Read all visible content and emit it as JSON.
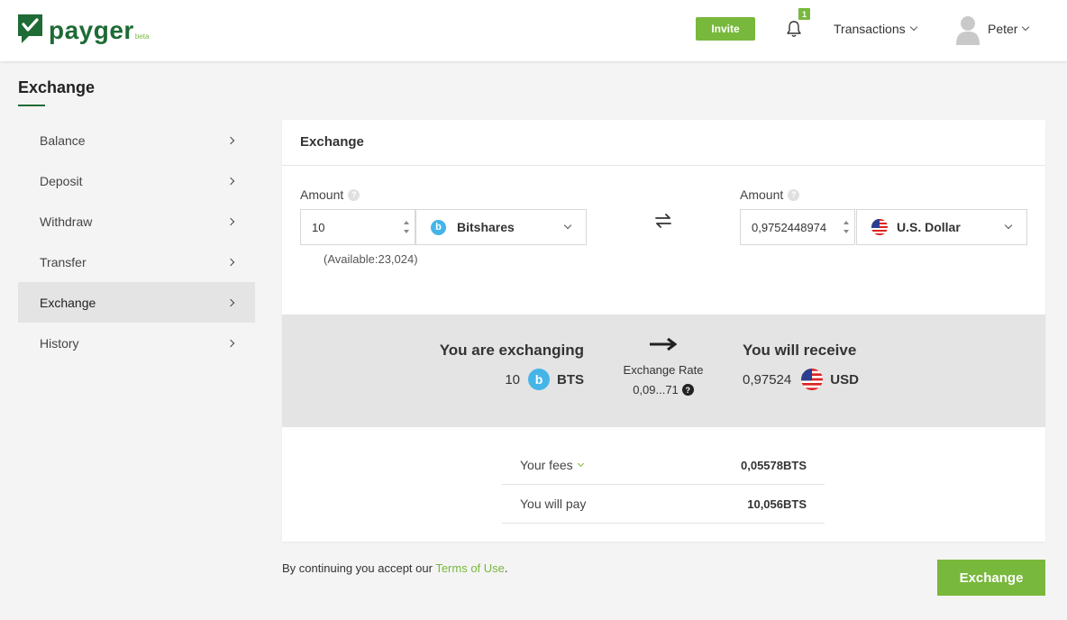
{
  "brand": {
    "name": "payger",
    "tag": "beta",
    "color": "#1e6b35",
    "accent": "#78b83c"
  },
  "header": {
    "invite_label": "Invite",
    "notifications_count": "1",
    "transactions_label": "Transactions",
    "user_name": "Peter"
  },
  "sidebar": {
    "title": "Exchange",
    "items": [
      {
        "label": "Balance"
      },
      {
        "label": "Deposit"
      },
      {
        "label": "Withdraw"
      },
      {
        "label": "Transfer"
      },
      {
        "label": "Exchange",
        "active": true
      },
      {
        "label": "History"
      }
    ]
  },
  "card": {
    "title": "Exchange",
    "from": {
      "amount_label": "Amount",
      "amount_value": "10",
      "currency": "Bitshares",
      "currency_icon": "bitshares-icon",
      "available": "(Available:23,024)"
    },
    "to": {
      "amount_label": "Amount",
      "amount_value": "0,9752448974",
      "currency": "U.S. Dollar",
      "currency_icon": "us-flag-icon"
    },
    "summary": {
      "exchanging_title": "You are exchanging",
      "exchanging_amount": "10",
      "exchanging_currency": "BTS",
      "rate_label": "Exchange Rate",
      "rate_value": "0,09...71",
      "receive_title": "You will receive",
      "receive_amount": "0,97524",
      "receive_currency": "USD"
    },
    "fees": {
      "fees_label": "Your fees",
      "fees_value": "0,05578BTS",
      "pay_label": "You will pay",
      "pay_value": "10,056BTS"
    }
  },
  "footer": {
    "terms_prefix": "By continuing you accept our ",
    "terms_link": "Terms of Use",
    "terms_suffix": ".",
    "exchange_button": "Exchange"
  }
}
